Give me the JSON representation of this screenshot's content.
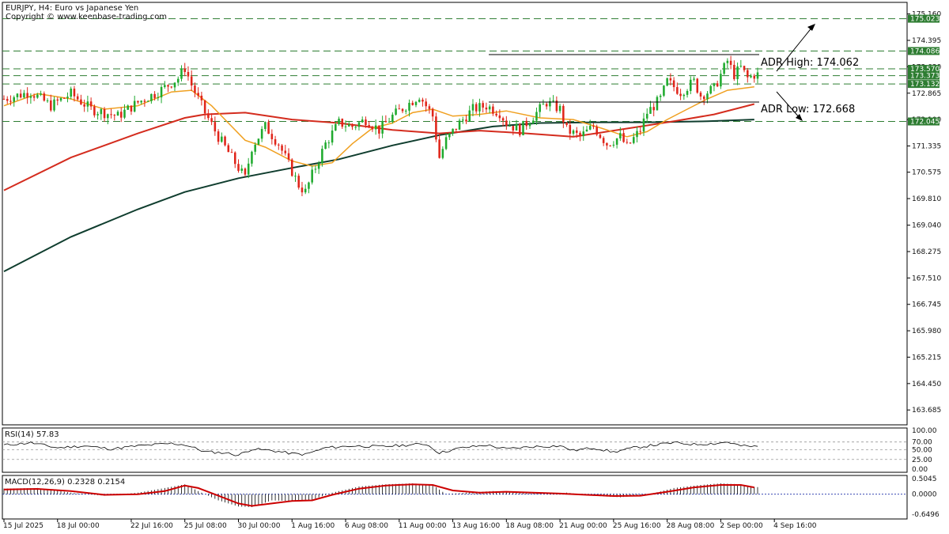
{
  "header": {
    "symbol_line": "EURJPY, H4:  Euro vs Japanese Yen",
    "copyright": "Copyright © www.keenbase-trading.com"
  },
  "colors": {
    "bull": "#1faa2e",
    "bear": "#e0251a",
    "ma_fast": "#f0a020",
    "ma_mid": "#d42c1e",
    "ma_slow": "#0f3d2e",
    "level": "#2e7d32",
    "rsi": "#000000",
    "macd_signal": "#cc0000",
    "macd_zero": "#1a2ea8"
  },
  "annotations": {
    "adr_high": "ADR High: 174.062",
    "adr_low": "ADR Low: 172.668"
  },
  "chart_data": {
    "type": "candlestick",
    "symbol": "EURJPY",
    "timeframe": "H4",
    "ylim": [
      163.3,
      175.45
    ],
    "y_ticks": [
      "175.160",
      "174.395",
      "173.630",
      "172.865",
      "172.100",
      "171.335",
      "170.575",
      "169.810",
      "169.040",
      "168.275",
      "167.510",
      "166.745",
      "165.980",
      "165.215",
      "164.450",
      "163.685"
    ],
    "levels": [
      {
        "value": 175.023,
        "label": "175.023"
      },
      {
        "value": 174.086,
        "label": "174.086"
      },
      {
        "value": 173.57,
        "label": "173.570"
      },
      {
        "value": 173.373,
        "label": "173.373"
      },
      {
        "value": 173.132,
        "label": "173.132"
      },
      {
        "value": 172.045,
        "label": "172.045"
      }
    ],
    "adr_high": 174.062,
    "adr_low": 172.668,
    "x_labels": [
      {
        "label": "15 Jul 2025",
        "index": 0
      },
      {
        "label": "18 Jul 00:00",
        "index": 16
      },
      {
        "label": "22 Jul 16:00",
        "index": 38
      },
      {
        "label": "25 Jul 08:00",
        "index": 54
      },
      {
        "label": "30 Jul 00:00",
        "index": 70
      },
      {
        "label": "1 Aug 16:00",
        "index": 86
      },
      {
        "label": "6 Aug 08:00",
        "index": 102
      },
      {
        "label": "11 Aug 00:00",
        "index": 118
      },
      {
        "label": "13 Aug 16:00",
        "index": 134
      },
      {
        "label": "18 Aug 08:00",
        "index": 150
      },
      {
        "label": "21 Aug 00:00",
        "index": 166
      },
      {
        "label": "25 Aug 16:00",
        "index": 182
      },
      {
        "label": "28 Aug 08:00",
        "index": 198
      },
      {
        "label": "2 Sep 00:00",
        "index": 214
      },
      {
        "label": "4 Sep 16:00",
        "index": 230
      }
    ],
    "close_path": [
      [
        0,
        172.7
      ],
      [
        8,
        172.9
      ],
      [
        14,
        172.5
      ],
      [
        20,
        172.85
      ],
      [
        26,
        172.4
      ],
      [
        34,
        172.2
      ],
      [
        40,
        172.6
      ],
      [
        46,
        172.9
      ],
      [
        52,
        173.3
      ],
      [
        54,
        173.6
      ],
      [
        56,
        173.1
      ],
      [
        60,
        172.3
      ],
      [
        64,
        171.6
      ],
      [
        68,
        171.0
      ],
      [
        72,
        170.4
      ],
      [
        74,
        171.3
      ],
      [
        78,
        171.9
      ],
      [
        82,
        171.4
      ],
      [
        86,
        170.6
      ],
      [
        88,
        170.2
      ],
      [
        90,
        170.0
      ],
      [
        92,
        170.5
      ],
      [
        96,
        171.4
      ],
      [
        100,
        172.0
      ],
      [
        104,
        171.9
      ],
      [
        108,
        172.1
      ],
      [
        112,
        171.8
      ],
      [
        116,
        172.2
      ],
      [
        120,
        172.5
      ],
      [
        124,
        172.8
      ],
      [
        128,
        172.2
      ],
      [
        130,
        171.0
      ],
      [
        132,
        171.5
      ],
      [
        136,
        172.0
      ],
      [
        140,
        172.4
      ],
      [
        144,
        172.5
      ],
      [
        148,
        172.3
      ],
      [
        150,
        172.0
      ],
      [
        154,
        171.8
      ],
      [
        158,
        172.2
      ],
      [
        162,
        172.6
      ],
      [
        166,
        172.4
      ],
      [
        168,
        171.8
      ],
      [
        172,
        171.6
      ],
      [
        176,
        171.9
      ],
      [
        180,
        171.4
      ],
      [
        184,
        171.6
      ],
      [
        186,
        171.3
      ],
      [
        190,
        171.8
      ],
      [
        192,
        172.3
      ],
      [
        196,
        172.7
      ],
      [
        198,
        173.2
      ],
      [
        202,
        172.9
      ],
      [
        206,
        173.2
      ],
      [
        208,
        172.8
      ],
      [
        212,
        173.0
      ],
      [
        214,
        173.4
      ],
      [
        216,
        173.8
      ],
      [
        218,
        173.4
      ],
      [
        220,
        173.6
      ],
      [
        222,
        173.3
      ],
      [
        224,
        173.4
      ]
    ],
    "ma_fast": [
      [
        0,
        172.5
      ],
      [
        10,
        172.85
      ],
      [
        20,
        172.7
      ],
      [
        30,
        172.4
      ],
      [
        40,
        172.5
      ],
      [
        50,
        172.9
      ],
      [
        56,
        172.95
      ],
      [
        62,
        172.5
      ],
      [
        66,
        172.1
      ],
      [
        72,
        171.5
      ],
      [
        78,
        171.3
      ],
      [
        86,
        170.9
      ],
      [
        92,
        170.75
      ],
      [
        98,
        170.85
      ],
      [
        104,
        171.4
      ],
      [
        110,
        171.85
      ],
      [
        116,
        172.0
      ],
      [
        122,
        172.3
      ],
      [
        128,
        172.4
      ],
      [
        134,
        172.2
      ],
      [
        142,
        172.25
      ],
      [
        150,
        172.35
      ],
      [
        160,
        172.15
      ],
      [
        170,
        172.1
      ],
      [
        180,
        171.8
      ],
      [
        186,
        171.6
      ],
      [
        192,
        171.75
      ],
      [
        198,
        172.1
      ],
      [
        204,
        172.4
      ],
      [
        210,
        172.7
      ],
      [
        216,
        172.95
      ],
      [
        224,
        173.05
      ]
    ],
    "ma_mid": [
      [
        0,
        170.05
      ],
      [
        20,
        171.0
      ],
      [
        40,
        171.7
      ],
      [
        54,
        172.15
      ],
      [
        60,
        172.25
      ],
      [
        72,
        172.3
      ],
      [
        86,
        172.1
      ],
      [
        100,
        172.0
      ],
      [
        116,
        171.8
      ],
      [
        130,
        171.7
      ],
      [
        142,
        171.78
      ],
      [
        156,
        171.7
      ],
      [
        170,
        171.6
      ],
      [
        180,
        171.75
      ],
      [
        190,
        171.9
      ],
      [
        200,
        172.05
      ],
      [
        212,
        172.25
      ],
      [
        224,
        172.55
      ]
    ],
    "ma_slow": [
      [
        0,
        167.7
      ],
      [
        20,
        168.7
      ],
      [
        40,
        169.5
      ],
      [
        54,
        170.0
      ],
      [
        70,
        170.4
      ],
      [
        86,
        170.7
      ],
      [
        100,
        170.95
      ],
      [
        116,
        171.35
      ],
      [
        130,
        171.65
      ],
      [
        146,
        171.9
      ],
      [
        160,
        172.0
      ],
      [
        176,
        172.02
      ],
      [
        192,
        172.02
      ],
      [
        210,
        172.05
      ],
      [
        224,
        172.1
      ]
    ],
    "rsi": {
      "title": "RSI(14) 57.83",
      "value": 57.83,
      "levels": [
        100,
        70,
        50,
        25,
        0
      ],
      "tick_labels": [
        "100.00",
        "70.00",
        "50.00",
        "25.00",
        "0.00"
      ],
      "series": [
        [
          0,
          62
        ],
        [
          8,
          68
        ],
        [
          16,
          55
        ],
        [
          24,
          60
        ],
        [
          32,
          52
        ],
        [
          40,
          60
        ],
        [
          50,
          66
        ],
        [
          54,
          63
        ],
        [
          60,
          45
        ],
        [
          66,
          42
        ],
        [
          70,
          36
        ],
        [
          74,
          52
        ],
        [
          80,
          48
        ],
        [
          86,
          40
        ],
        [
          90,
          38
        ],
        [
          96,
          55
        ],
        [
          104,
          60
        ],
        [
          112,
          58
        ],
        [
          120,
          62
        ],
        [
          126,
          65
        ],
        [
          130,
          42
        ],
        [
          136,
          54
        ],
        [
          144,
          62
        ],
        [
          150,
          52
        ],
        [
          158,
          58
        ],
        [
          166,
          60
        ],
        [
          170,
          48
        ],
        [
          176,
          55
        ],
        [
          182,
          44
        ],
        [
          188,
          55
        ],
        [
          194,
          62
        ],
        [
          200,
          68
        ],
        [
          206,
          64
        ],
        [
          212,
          66
        ],
        [
          216,
          70
        ],
        [
          220,
          60
        ],
        [
          224,
          58
        ]
      ]
    },
    "macd": {
      "title": "MACD(12,26,9) 0.2328 0.2154",
      "params": "12,26,9",
      "main": 0.2328,
      "signal": 0.2154,
      "ylim": [
        -0.6496,
        0.5045
      ],
      "tick_labels": [
        "0.5045",
        "0.0000",
        "-0.6496"
      ],
      "histogram": [
        [
          0,
          0.18
        ],
        [
          10,
          0.2
        ],
        [
          20,
          0.05
        ],
        [
          30,
          -0.05
        ],
        [
          40,
          0.05
        ],
        [
          48,
          0.2
        ],
        [
          54,
          0.32
        ],
        [
          58,
          0.1
        ],
        [
          64,
          -0.2
        ],
        [
          70,
          -0.4
        ],
        [
          74,
          -0.42
        ],
        [
          80,
          -0.2
        ],
        [
          86,
          -0.22
        ],
        [
          92,
          -0.18
        ],
        [
          98,
          0.05
        ],
        [
          106,
          0.25
        ],
        [
          114,
          0.32
        ],
        [
          122,
          0.35
        ],
        [
          128,
          0.3
        ],
        [
          132,
          0.0
        ],
        [
          138,
          0.05
        ],
        [
          146,
          0.1
        ],
        [
          154,
          0.06
        ],
        [
          162,
          0.0
        ],
        [
          168,
          0.05
        ],
        [
          176,
          -0.05
        ],
        [
          184,
          -0.1
        ],
        [
          192,
          -0.02
        ],
        [
          200,
          0.2
        ],
        [
          208,
          0.3
        ],
        [
          214,
          0.35
        ],
        [
          220,
          0.32
        ],
        [
          224,
          0.23
        ]
      ],
      "signal_series": [
        [
          0,
          0.15
        ],
        [
          10,
          0.17
        ],
        [
          20,
          0.1
        ],
        [
          30,
          -0.02
        ],
        [
          40,
          0.0
        ],
        [
          48,
          0.1
        ],
        [
          54,
          0.28
        ],
        [
          58,
          0.2
        ],
        [
          64,
          -0.05
        ],
        [
          70,
          -0.3
        ],
        [
          74,
          -0.38
        ],
        [
          80,
          -0.3
        ],
        [
          86,
          -0.22
        ],
        [
          92,
          -0.2
        ],
        [
          98,
          -0.02
        ],
        [
          106,
          0.18
        ],
        [
          114,
          0.28
        ],
        [
          122,
          0.32
        ],
        [
          128,
          0.3
        ],
        [
          134,
          0.12
        ],
        [
          142,
          0.05
        ],
        [
          150,
          0.08
        ],
        [
          158,
          0.05
        ],
        [
          166,
          0.02
        ],
        [
          174,
          -0.02
        ],
        [
          182,
          -0.06
        ],
        [
          190,
          -0.05
        ],
        [
          198,
          0.08
        ],
        [
          206,
          0.22
        ],
        [
          214,
          0.3
        ],
        [
          220,
          0.3
        ],
        [
          224,
          0.22
        ]
      ]
    }
  }
}
